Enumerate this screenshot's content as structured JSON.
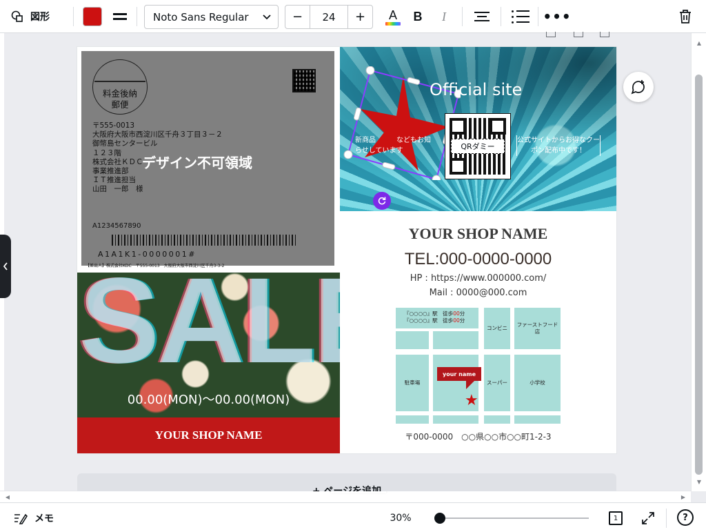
{
  "toolbar": {
    "shape_label": "図形",
    "fill_color": "#cc1111",
    "font_name": "Noto Sans Regular",
    "font_size": "24",
    "decrease": "−",
    "increase": "+",
    "text_color_letter": "A",
    "bold_letter": "B",
    "italic_letter": "I",
    "more": "•••"
  },
  "canvas": {
    "postal": {
      "stamp_line1": "料金後納",
      "stamp_line2": "郵便",
      "address": "〒555-0013\n大阪府大阪市西淀川区千舟３丁目３－２\n御幣島センタービル\n１２３階\n株式会社ＫＤＣ\n事業推進部\nＩＴ推進担当\n山田　一郎　様",
      "non_design_area": "デザイン不可領域",
      "customer_id": "A1234567890",
      "barcode_number": "A1A1K1-0000001#",
      "return_address": "【差出人】株式会社KDC　〒555-0013　大阪府大阪市西淀川区千舟3-3-2"
    },
    "photo": {
      "official_site": "Official site",
      "banner_left": "新商品　　　などもお知らせしています",
      "banner_right": "公式サイトからお得なクーポン配布中です！",
      "qr_label": "QRダミー"
    },
    "sale": {
      "word": "SALE",
      "dates": "00.00(MON)〜00.00(MON)",
      "shop_name": "YOUR SHOP NAME"
    },
    "info": {
      "shop_name": "YOUR SHOP NAME",
      "tel": "TEL:000-0000-0000",
      "hp": "HP : https://www.000000.com/",
      "mail": "Mail : 0000@000.com",
      "postal_address": "〒000-0000　○○県○○市○○町1-2-3"
    },
    "map": {
      "station1_name": "『○○○○』駅　徒歩",
      "station1_min": "00",
      "station2_name": "『○○○○』駅　徒歩",
      "station2_min": "00",
      "unit": "分",
      "convenience": "コンビニ",
      "fastfood": "ファーストフード店",
      "parking": "駐車場",
      "supermarket": "スーパー",
      "school": "小学校",
      "pin_label": "your name"
    },
    "add_page": "+ ページを追加"
  },
  "bottom": {
    "memo_label": "メモ",
    "zoom": "30%",
    "zoom_level": 0.01,
    "page_count": "1",
    "help": "?"
  },
  "colors": {
    "accent": "#7d2ae8",
    "shop_red": "#c01818",
    "map_block": "#a9ddd8"
  }
}
